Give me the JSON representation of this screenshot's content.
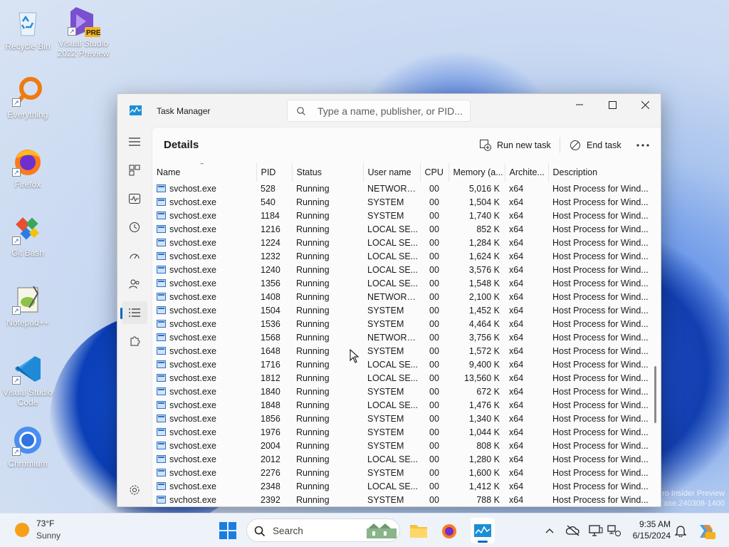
{
  "desktop": {
    "icons": [
      {
        "label": "Recycle Bin",
        "icon": "recycle-bin-icon"
      },
      {
        "label": "Visual Studio 2022 Preview",
        "badge": "PRE",
        "icon": "visual-studio-icon"
      },
      {
        "label": "Everything",
        "icon": "everything-search-icon"
      },
      {
        "label": "Firefox",
        "icon": "firefox-icon"
      },
      {
        "label": "Git Bash",
        "icon": "git-bash-icon"
      },
      {
        "label": "Notepad++",
        "icon": "notepad-plus-plus-icon"
      },
      {
        "label": "Visual Studio Code",
        "icon": "vscode-icon"
      },
      {
        "label": "Chromium",
        "icon": "chromium-icon"
      }
    ],
    "watermark_line1": "ro Insider Preview",
    "watermark_line2": "ase.240308-1400"
  },
  "window": {
    "title": "Task Manager",
    "search_placeholder": "Type a name, publisher, or PID...",
    "page_title": "Details",
    "run_new_task": "Run new task",
    "end_task": "End task",
    "nav_active": "details"
  },
  "table": {
    "columns": [
      "Name",
      "PID",
      "Status",
      "User name",
      "CPU",
      "Memory (a...",
      "Archite...",
      "Description"
    ],
    "rows": [
      [
        "svchost.exe",
        "528",
        "Running",
        "NETWORK...",
        "00",
        "5,016 K",
        "x64",
        "Host Process for Wind..."
      ],
      [
        "svchost.exe",
        "540",
        "Running",
        "SYSTEM",
        "00",
        "1,504 K",
        "x64",
        "Host Process for Wind..."
      ],
      [
        "svchost.exe",
        "1184",
        "Running",
        "SYSTEM",
        "00",
        "1,740 K",
        "x64",
        "Host Process for Wind..."
      ],
      [
        "svchost.exe",
        "1216",
        "Running",
        "LOCAL SE...",
        "00",
        "852 K",
        "x64",
        "Host Process for Wind..."
      ],
      [
        "svchost.exe",
        "1224",
        "Running",
        "LOCAL SE...",
        "00",
        "1,284 K",
        "x64",
        "Host Process for Wind..."
      ],
      [
        "svchost.exe",
        "1232",
        "Running",
        "LOCAL SE...",
        "00",
        "1,624 K",
        "x64",
        "Host Process for Wind..."
      ],
      [
        "svchost.exe",
        "1240",
        "Running",
        "LOCAL SE...",
        "00",
        "3,576 K",
        "x64",
        "Host Process for Wind..."
      ],
      [
        "svchost.exe",
        "1356",
        "Running",
        "LOCAL SE...",
        "00",
        "1,548 K",
        "x64",
        "Host Process for Wind..."
      ],
      [
        "svchost.exe",
        "1408",
        "Running",
        "NETWORK...",
        "00",
        "2,100 K",
        "x64",
        "Host Process for Wind..."
      ],
      [
        "svchost.exe",
        "1504",
        "Running",
        "SYSTEM",
        "00",
        "1,452 K",
        "x64",
        "Host Process for Wind..."
      ],
      [
        "svchost.exe",
        "1536",
        "Running",
        "SYSTEM",
        "00",
        "4,464 K",
        "x64",
        "Host Process for Wind..."
      ],
      [
        "svchost.exe",
        "1568",
        "Running",
        "NETWORK...",
        "00",
        "3,756 K",
        "x64",
        "Host Process for Wind..."
      ],
      [
        "svchost.exe",
        "1648",
        "Running",
        "SYSTEM",
        "00",
        "1,572 K",
        "x64",
        "Host Process for Wind..."
      ],
      [
        "svchost.exe",
        "1716",
        "Running",
        "LOCAL SE...",
        "00",
        "9,400 K",
        "x64",
        "Host Process for Wind..."
      ],
      [
        "svchost.exe",
        "1812",
        "Running",
        "LOCAL SE...",
        "00",
        "13,560 K",
        "x64",
        "Host Process for Wind..."
      ],
      [
        "svchost.exe",
        "1840",
        "Running",
        "SYSTEM",
        "00",
        "672 K",
        "x64",
        "Host Process for Wind..."
      ],
      [
        "svchost.exe",
        "1848",
        "Running",
        "LOCAL SE...",
        "00",
        "1,476 K",
        "x64",
        "Host Process for Wind..."
      ],
      [
        "svchost.exe",
        "1856",
        "Running",
        "SYSTEM",
        "00",
        "1,340 K",
        "x64",
        "Host Process for Wind..."
      ],
      [
        "svchost.exe",
        "1976",
        "Running",
        "SYSTEM",
        "00",
        "1,044 K",
        "x64",
        "Host Process for Wind..."
      ],
      [
        "svchost.exe",
        "2004",
        "Running",
        "SYSTEM",
        "00",
        "808 K",
        "x64",
        "Host Process for Wind..."
      ],
      [
        "svchost.exe",
        "2012",
        "Running",
        "LOCAL SE...",
        "00",
        "1,280 K",
        "x64",
        "Host Process for Wind..."
      ],
      [
        "svchost.exe",
        "2276",
        "Running",
        "SYSTEM",
        "00",
        "1,600 K",
        "x64",
        "Host Process for Wind..."
      ],
      [
        "svchost.exe",
        "2348",
        "Running",
        "LOCAL SE...",
        "00",
        "1,412 K",
        "x64",
        "Host Process for Wind..."
      ],
      [
        "svchost.exe",
        "2392",
        "Running",
        "SYSTEM",
        "00",
        "788 K",
        "x64",
        "Host Process for Wind..."
      ]
    ]
  },
  "taskbar": {
    "temperature": "73°F",
    "weather": "Sunny",
    "search_label": "Search",
    "time": "9:35 AM",
    "date": "6/15/2024"
  },
  "colors": {
    "accent": "#0067c0",
    "wallpaper_blue": "#1f58d6"
  }
}
